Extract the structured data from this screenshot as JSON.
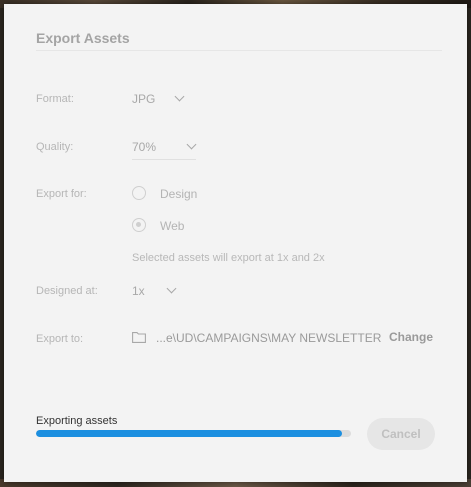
{
  "dialog": {
    "title": "Export Assets",
    "format": {
      "label": "Format:",
      "value": "JPG"
    },
    "quality": {
      "label": "Quality:",
      "value": "70%"
    },
    "export_for": {
      "label": "Export for:",
      "options": [
        {
          "label": "Design",
          "selected": false
        },
        {
          "label": "Web",
          "selected": true
        }
      ],
      "note": "Selected assets will export at 1x and 2x"
    },
    "designed_at": {
      "label": "Designed at:",
      "value": "1x"
    },
    "export_to": {
      "label": "Export to:",
      "path": "...e\\UD\\CAMPAIGNS\\MAY NEWSLETTER",
      "change_label": "Change",
      "icon": "folder-icon"
    },
    "progress": {
      "label": "Exporting assets",
      "fraction": 0.97
    },
    "cancel_label": "Cancel"
  },
  "colors": {
    "progress_fill": "#1c8fe0",
    "dialog_bg": "#f3f3f3"
  }
}
